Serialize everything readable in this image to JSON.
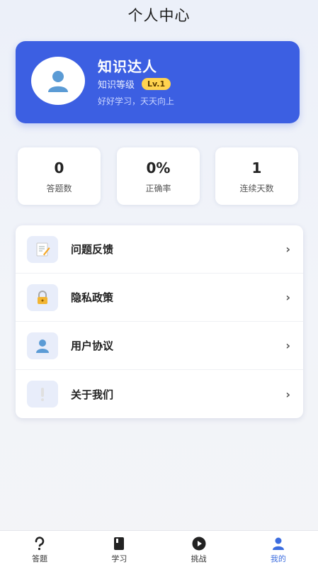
{
  "header": {
    "title": "个人中心"
  },
  "profile": {
    "name": "知识达人",
    "level_label": "知识等级",
    "level_badge": "Lv.1",
    "motto": "好好学习，天天向上"
  },
  "stats": [
    {
      "value": "0",
      "label": "答题数"
    },
    {
      "value": "0%",
      "label": "正确率"
    },
    {
      "value": "1",
      "label": "连续天数"
    }
  ],
  "menu": {
    "items": [
      {
        "label": "问题反馈",
        "icon": "memo-icon",
        "arrow": "›"
      },
      {
        "label": "隐私政策",
        "icon": "lock-icon",
        "arrow": "›"
      },
      {
        "label": "用户协议",
        "icon": "user-icon",
        "arrow": "›"
      },
      {
        "label": "关于我们",
        "icon": "exclamation-icon",
        "arrow": "›"
      }
    ]
  },
  "tabbar": {
    "tabs": [
      {
        "label": "答题",
        "icon": "question-icon"
      },
      {
        "label": "学习",
        "icon": "book-icon"
      },
      {
        "label": "挑战",
        "icon": "play-icon"
      },
      {
        "label": "我的",
        "icon": "person-icon",
        "active": true
      }
    ]
  },
  "colors": {
    "primary": "#3c5fe2",
    "badge": "#ffd34f",
    "tab_active": "#3c6ddf"
  }
}
